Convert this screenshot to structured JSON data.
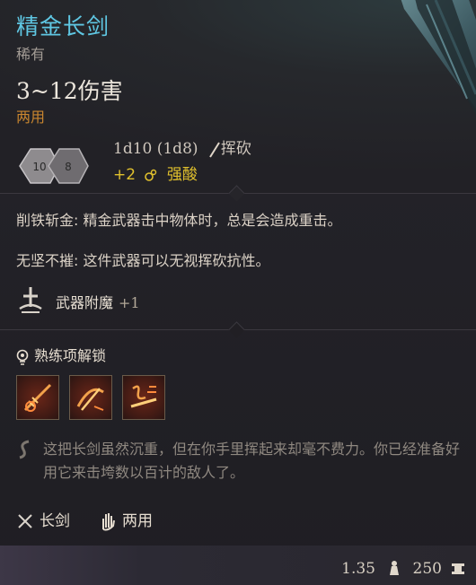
{
  "item": {
    "name": "精金长剑",
    "rarity": "稀有",
    "damage": "3~12伤害",
    "handedness": "两用",
    "dice_formula": "1d10 (1d8)",
    "damage_type": "挥砍",
    "bonus_damage": "+2",
    "bonus_type": "强酸",
    "dice_faces": [
      "10",
      "8"
    ]
  },
  "passives": [
    {
      "name": "削铁斩金",
      "text": "削铁斩金: 精金武器击中物体时，总是会造成重击。"
    },
    {
      "name": "无坚不摧",
      "text": "无坚不摧: 这件武器可以无视挥砍抗性。"
    }
  ],
  "enchantment": {
    "label": "武器附魔",
    "value": "+1"
  },
  "proficiency": {
    "header": "熟练项解锁",
    "skills": [
      "skill-1",
      "skill-2",
      "skill-3"
    ]
  },
  "lore": "这把长剑虽然沉重，但在你手里挥起来却毫不费力。你已经准备好用它来击垮数以百计的敌人了。",
  "tags": {
    "weapon_type": "长剑",
    "hands": "两用"
  },
  "footer": {
    "weight": "1.35",
    "price": "250"
  },
  "colors": {
    "title": "#5fc7e3",
    "handed": "#c9862f",
    "acid": "#e0c02d",
    "lore": "#8f8880"
  }
}
